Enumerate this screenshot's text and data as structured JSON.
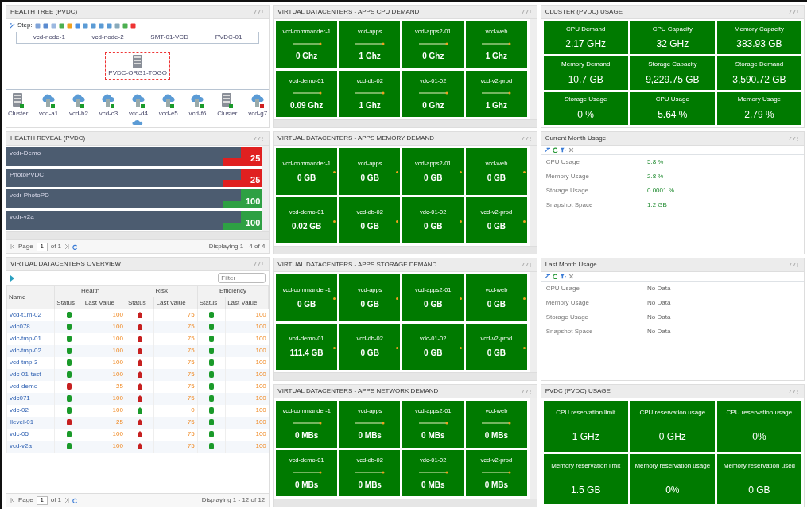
{
  "columns": [
    {
      "panels": [
        {
          "kind": "topology",
          "title": "HEALTH TREE (PVDC)",
          "toolbar_label": "Step:",
          "group_nodes": [
            {
              "label": "vcd-node-1"
            },
            {
              "label": "vcd-node-2"
            },
            {
              "label": "SMT-01-VCD"
            },
            {
              "label": "PVDC-01"
            }
          ],
          "center": {
            "label": "PVDC-ORG1-TOGO",
            "selected": true
          },
          "nodes": [
            {
              "kind": "server",
              "label": "Cluster",
              "color": "#1a9a2a"
            },
            {
              "kind": "vdc",
              "label": "vcd-a1",
              "color": "#1a9a2a"
            },
            {
              "kind": "vdc",
              "label": "vcd-b2",
              "color": "#1a9a2a"
            },
            {
              "kind": "vdc",
              "label": "vcd-c3",
              "color": "#1a9a2a"
            },
            {
              "kind": "vdc",
              "label": "vcd-d4",
              "color": "#1a9a2a"
            },
            {
              "kind": "vdc",
              "label": "vcd-e5",
              "color": "#1a9a2a"
            },
            {
              "kind": "vdc",
              "label": "vcd-f6",
              "color": "#1a9a2a"
            },
            {
              "kind": "server",
              "label": "Cluster",
              "color": "#1a9a2a"
            },
            {
              "kind": "vdc",
              "label": "vcd-g7",
              "color": "#d02020"
            }
          ]
        },
        {
          "kind": "health_bars",
          "title": "HEALTH REVEAL (PVDC)",
          "rows": [
            {
              "name": "vcdr-Demo",
              "value": "25",
              "color": "#e02020"
            },
            {
              "name": "PhotoPVDC",
              "value": "25",
              "color": "#e02020"
            },
            {
              "name": "vcdr-PhotoPD",
              "value": "100",
              "color": "#2ea043"
            },
            {
              "name": "vcdr-v2a",
              "value": "100",
              "color": "#2ea043"
            }
          ],
          "pager": {
            "page_label": "Page",
            "page": "1",
            "of": "of 1",
            "display": "Displaying 1 - 4 of 4"
          }
        },
        {
          "kind": "table",
          "title": "VIRTUAL DATACENTERS OVERVIEW",
          "search": {
            "placeholder": "Filter"
          },
          "name_col": "Name",
          "groups": [
            {
              "label": "Health",
              "sub": [
                "Status",
                "Last Value"
              ]
            },
            {
              "label": "Risk",
              "sub": [
                "Status",
                "Last Value"
              ]
            },
            {
              "label": "Efficiency",
              "sub": [
                "Status",
                "Last Value"
              ]
            }
          ],
          "rows": [
            {
              "name": "vcd-t1m-02",
              "cells": [
                {
                  "ok": true,
                  "value": "100"
                },
                {
                  "ok": false,
                  "value": "75"
                },
                {
                  "ok": true,
                  "value": "100"
                }
              ]
            },
            {
              "name": "vdc078",
              "cells": [
                {
                  "ok": true,
                  "value": "100"
                },
                {
                  "ok": false,
                  "value": "75"
                },
                {
                  "ok": true,
                  "value": "100"
                }
              ]
            },
            {
              "name": "vdc-tmp-01",
              "cells": [
                {
                  "ok": true,
                  "value": "100"
                },
                {
                  "ok": false,
                  "value": "75"
                },
                {
                  "ok": true,
                  "value": "100"
                }
              ]
            },
            {
              "name": "vdc-tmp-02",
              "cells": [
                {
                  "ok": true,
                  "value": "100"
                },
                {
                  "ok": false,
                  "value": "75"
                },
                {
                  "ok": true,
                  "value": "100"
                }
              ]
            },
            {
              "name": "vcd-tmp-3",
              "cells": [
                {
                  "ok": true,
                  "value": "100"
                },
                {
                  "ok": false,
                  "value": "75"
                },
                {
                  "ok": true,
                  "value": "100"
                }
              ]
            },
            {
              "name": "vdc-01-test",
              "cells": [
                {
                  "ok": true,
                  "value": "100"
                },
                {
                  "ok": false,
                  "value": "75"
                },
                {
                  "ok": true,
                  "value": "100"
                }
              ]
            },
            {
              "name": "vcd-demo",
              "cells": [
                {
                  "ok": false,
                  "value": "25"
                },
                {
                  "ok": false,
                  "value": "75"
                },
                {
                  "ok": true,
                  "value": "100"
                }
              ]
            },
            {
              "name": "vdc071",
              "cells": [
                {
                  "ok": true,
                  "value": "100"
                },
                {
                  "ok": false,
                  "value": "75"
                },
                {
                  "ok": true,
                  "value": "100"
                }
              ]
            },
            {
              "name": "vdc-02",
              "cells": [
                {
                  "ok": true,
                  "value": "100"
                },
                {
                  "ok": true,
                  "value": "0"
                },
                {
                  "ok": true,
                  "value": "100"
                }
              ]
            },
            {
              "name": "Ilevel-01",
              "cells": [
                {
                  "ok": false,
                  "value": "25"
                },
                {
                  "ok": false,
                  "value": "75"
                },
                {
                  "ok": true,
                  "value": "100"
                }
              ]
            },
            {
              "name": "vdc-05",
              "cells": [
                {
                  "ok": true,
                  "value": "100"
                },
                {
                  "ok": false,
                  "value": "75"
                },
                {
                  "ok": true,
                  "value": "100"
                }
              ]
            },
            {
              "name": "vcd-v2a",
              "cells": [
                {
                  "ok": true,
                  "value": "100"
                },
                {
                  "ok": false,
                  "value": "75"
                },
                {
                  "ok": true,
                  "value": "100"
                }
              ]
            }
          ],
          "pager": {
            "page_label": "Page",
            "page": "1",
            "of": "of 1",
            "display": "Displaying 1 - 12 of 12"
          }
        }
      ]
    },
    {
      "panels": [
        {
          "kind": "tiles",
          "title": "VIRTUAL DATACENTERS - APPS CPU DEMAND",
          "trend_line": true,
          "tiles": [
            {
              "label": "vcd-commander-1",
              "value": "0 Ghz"
            },
            {
              "label": "vcd-apps",
              "value": "1 Ghz"
            },
            {
              "label": "vcd-apps2-01",
              "value": "0 Ghz"
            },
            {
              "label": "vcd-web",
              "value": "1 Ghz"
            },
            {
              "label": "vcd-demo-01",
              "value": "0.09 Ghz"
            },
            {
              "label": "vcd-db-02",
              "value": "1 Ghz"
            },
            {
              "label": "vdc-01-02",
              "value": "0 Ghz"
            },
            {
              "label": "vcd-v2-prod",
              "value": "1 Ghz"
            }
          ]
        },
        {
          "kind": "tiles",
          "title": "VIRTUAL DATACENTERS - APPS MEMORY DEMAND",
          "trend_line": false,
          "tiles": [
            {
              "label": "vcd-commander-1",
              "value": "0 GB"
            },
            {
              "label": "vcd-apps",
              "value": "0 GB"
            },
            {
              "label": "vcd-apps2-01",
              "value": "0 GB"
            },
            {
              "label": "vcd-web",
              "value": "0 GB"
            },
            {
              "label": "vcd-demo-01",
              "value": "0.02 GB"
            },
            {
              "label": "vcd-db-02",
              "value": "0 GB"
            },
            {
              "label": "vdc-01-02",
              "value": "0 GB"
            },
            {
              "label": "vcd-v2-prod",
              "value": "0 GB"
            }
          ]
        },
        {
          "kind": "tiles",
          "title": "VIRTUAL DATACENTERS - APPS STORAGE DEMAND",
          "trend_line": false,
          "tiles": [
            {
              "label": "vcd-commander-1",
              "value": "0 GB"
            },
            {
              "label": "vcd-apps",
              "value": "0 GB"
            },
            {
              "label": "vcd-apps2-01",
              "value": "0 GB"
            },
            {
              "label": "vcd-web",
              "value": "0 GB"
            },
            {
              "label": "vcd-demo-01",
              "value": "111.4 GB"
            },
            {
              "label": "vcd-db-02",
              "value": "0 GB"
            },
            {
              "label": "vdc-01-02",
              "value": "0 GB"
            },
            {
              "label": "vcd-v2-prod",
              "value": "0 GB"
            }
          ]
        },
        {
          "kind": "tiles",
          "title": "VIRTUAL DATACENTERS - APPS NETWORK DEMAND",
          "trend_line": true,
          "tiles": [
            {
              "label": "vcd-commander-1",
              "value": "0 MBs"
            },
            {
              "label": "vcd-apps",
              "value": "0 MBs"
            },
            {
              "label": "vcd-apps2-01",
              "value": "0 MBs"
            },
            {
              "label": "vcd-web",
              "value": "0 MBs"
            },
            {
              "label": "vcd-demo-01",
              "value": "0 MBs"
            },
            {
              "label": "vcd-db-02",
              "value": "0 MBs"
            },
            {
              "label": "vdc-01-02",
              "value": "0 MBs"
            },
            {
              "label": "vcd-v2-prod",
              "value": "0 MBs"
            }
          ]
        }
      ]
    },
    {
      "panels": [
        {
          "kind": "stats",
          "title": "CLUSTER (PVDC) USAGE",
          "tiles": [
            {
              "label": "CPU Demand",
              "value": "2.17 GHz"
            },
            {
              "label": "CPU Capacity",
              "value": "32 GHz"
            },
            {
              "label": "Memory Capacity",
              "value": "383.93 GB"
            },
            {
              "label": "Memory Demand",
              "value": "10.7 GB"
            },
            {
              "label": "Storage Capacity",
              "value": "9,229.75 GB"
            },
            {
              "label": "Storage Demand",
              "value": "3,590.72 GB"
            },
            {
              "label": "Storage Usage",
              "value": "0 %"
            },
            {
              "label": "CPU Usage",
              "value": "5.64 %"
            },
            {
              "label": "Memory Usage",
              "value": "2.79 %"
            }
          ]
        },
        {
          "kind": "usage",
          "title": "Current Month Usage",
          "highlight": true,
          "rows": [
            {
              "label": "CPU Usage",
              "value": "5.8 %"
            },
            {
              "label": "Memory Usage",
              "value": "2.8 %"
            },
            {
              "label": "Storage Usage",
              "value": "0.0001 %"
            },
            {
              "label": "Snapshot Space",
              "value": "1.2 GB"
            }
          ]
        },
        {
          "kind": "usage",
          "title": "Last Month Usage",
          "highlight": false,
          "rows": [
            {
              "label": "CPU Usage",
              "value": "No Data"
            },
            {
              "label": "Memory Usage",
              "value": "No Data"
            },
            {
              "label": "Storage Usage",
              "value": "No Data"
            },
            {
              "label": "Snapshot Space",
              "value": "No Data"
            }
          ]
        },
        {
          "kind": "stats",
          "title": "PVDC (PVDC) USAGE",
          "tiles": [
            {
              "label": "CPU reservation limit",
              "value": "1 GHz"
            },
            {
              "label": "CPU reservation usage",
              "value": "0 GHz"
            },
            {
              "label": "CPU reservation usage",
              "value": "0%"
            },
            {
              "label": "Memory reservation limit",
              "value": "1.5 GB"
            },
            {
              "label": "Memory reservation usage",
              "value": "0%"
            },
            {
              "label": "Memory reservation used",
              "value": "0 GB"
            }
          ]
        }
      ]
    }
  ]
}
